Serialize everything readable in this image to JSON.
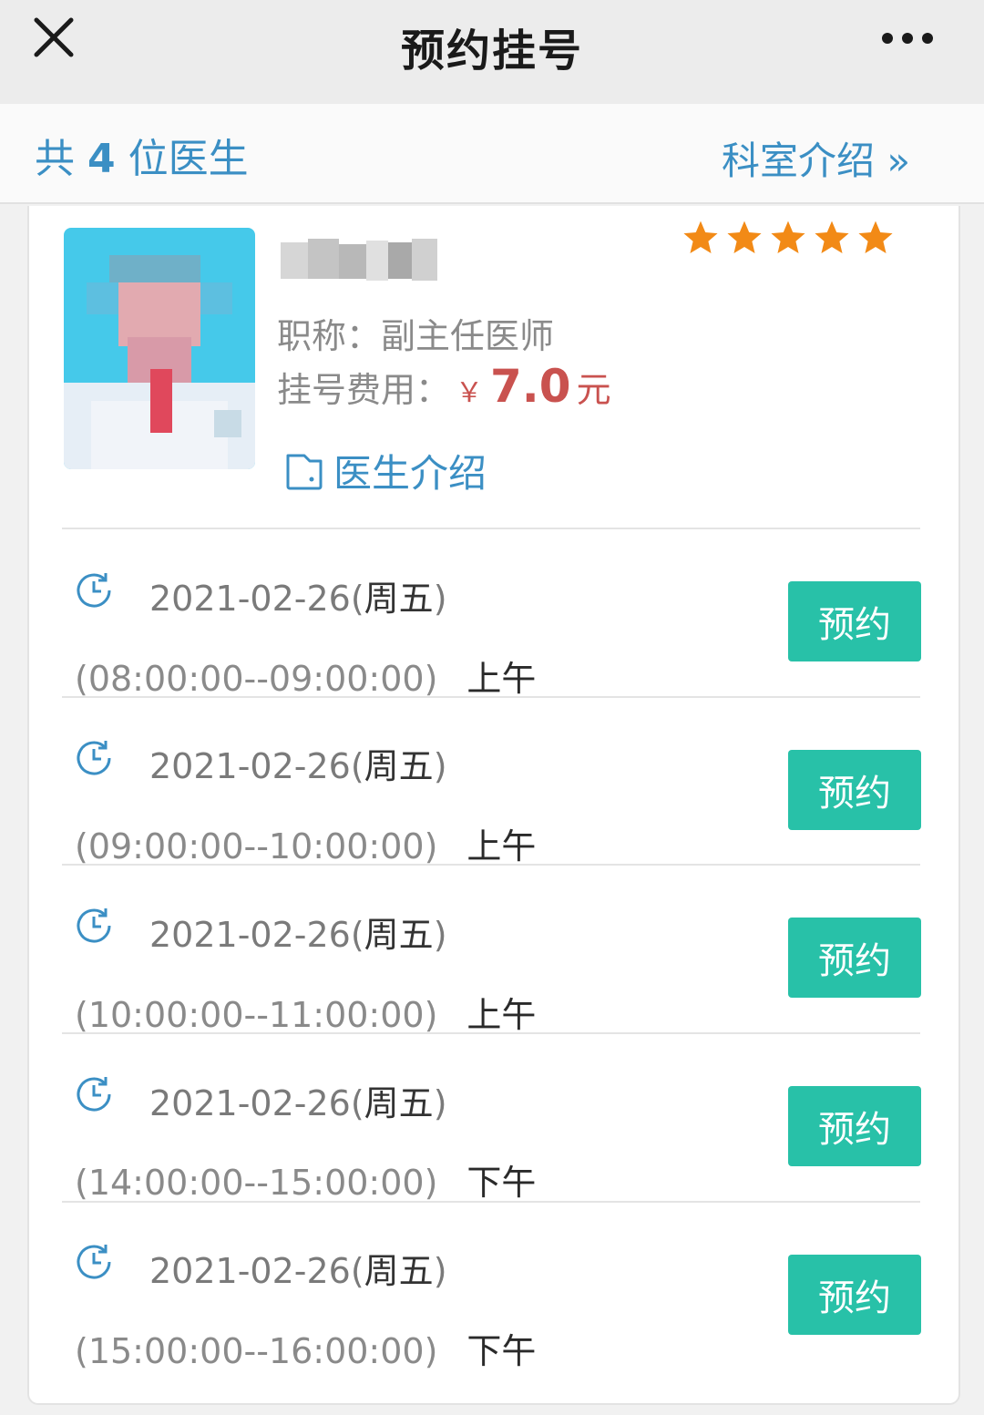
{
  "nav": {
    "title": "预约挂号"
  },
  "subheader": {
    "count_prefix": "共 ",
    "count": "4",
    "count_suffix": " 位医生",
    "dept_link": "科室介绍",
    "dept_chevron": "»"
  },
  "doctor": {
    "rating": 5,
    "title_label": "职称：",
    "title_value": "副主任医师",
    "fee_label": "挂号费用：",
    "fee_currency": "￥",
    "fee_value": "7.0",
    "fee_unit": "元",
    "intro_link": "医生介绍"
  },
  "colors": {
    "accent": "#3b8fc4",
    "button": "#28c1a8",
    "price": "#c9524f",
    "star": "#f28a16"
  },
  "slots": [
    {
      "date": "2021-02-26(",
      "weekday": "周五",
      "close": ")",
      "time": "(08:00:00--09:00:00)",
      "period": "上午",
      "button": "预约"
    },
    {
      "date": "2021-02-26(",
      "weekday": "周五",
      "close": ")",
      "time": "(09:00:00--10:00:00)",
      "period": "上午",
      "button": "预约"
    },
    {
      "date": "2021-02-26(",
      "weekday": "周五",
      "close": ")",
      "time": "(10:00:00--11:00:00)",
      "period": "上午",
      "button": "预约"
    },
    {
      "date": "2021-02-26(",
      "weekday": "周五",
      "close": ")",
      "time": "(14:00:00--15:00:00)",
      "period": "下午",
      "button": "预约"
    },
    {
      "date": "2021-02-26(",
      "weekday": "周五",
      "close": ")",
      "time": "(15:00:00--16:00:00)",
      "period": "下午",
      "button": "预约"
    }
  ],
  "icons": {
    "close": "close-icon",
    "more": "more-icon",
    "star": "star-icon",
    "intro": "folder-icon",
    "clock": "clock-icon"
  }
}
